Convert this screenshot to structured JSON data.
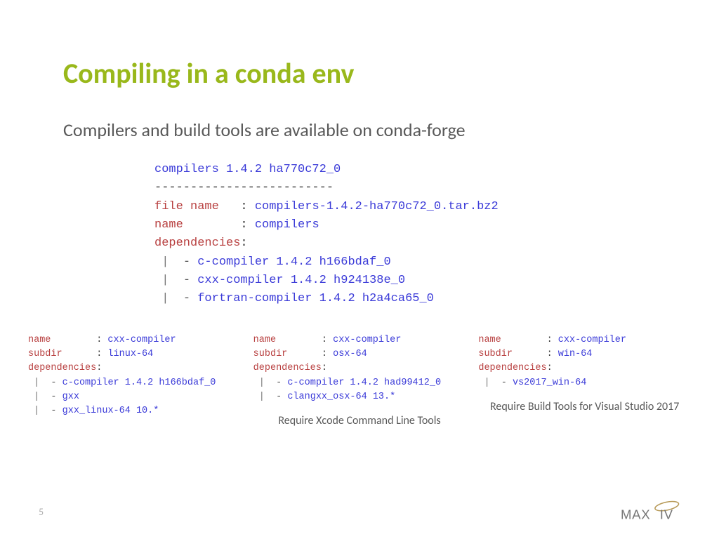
{
  "title": "Compiling in a conda env",
  "subtitle": "Compilers and build tools are available on conda-forge",
  "pageNumber": "5",
  "mainBlock": {
    "header": "compilers 1.4.2 ha770c72_0",
    "divider": "-------------------------",
    "rows": [
      {
        "key": "file name   ",
        "sep": ": ",
        "val": "compilers-1.4.2-ha770c72_0.tar.bz2"
      },
      {
        "key": "name        ",
        "sep": ": ",
        "val": "compilers"
      },
      {
        "key": "dependencies",
        "sep": ":",
        "val": ""
      }
    ],
    "deps": [
      "c-compiler 1.4.2 h166bdaf_0",
      "cxx-compiler 1.4.2 h924138e_0",
      "fortran-compiler 1.4.2 h2a4ca65_0"
    ]
  },
  "columns": [
    {
      "rows": [
        {
          "key": "name        ",
          "sep": ": ",
          "val": "cxx-compiler"
        },
        {
          "key": "subdir      ",
          "sep": ": ",
          "val": "linux-64"
        },
        {
          "key": "dependencies",
          "sep": ":",
          "val": ""
        }
      ],
      "deps": [
        "c-compiler 1.4.2 h166bdaf_0",
        "gxx",
        "gxx_linux-64 10.*"
      ],
      "caption": ""
    },
    {
      "rows": [
        {
          "key": "name        ",
          "sep": ": ",
          "val": "cxx-compiler"
        },
        {
          "key": "subdir      ",
          "sep": ": ",
          "val": "osx-64"
        },
        {
          "key": "dependencies",
          "sep": ":",
          "val": ""
        }
      ],
      "deps": [
        "c-compiler 1.4.2 had99412_0",
        "clangxx_osx-64 13.*"
      ],
      "caption": "Require Xcode Command Line Tools"
    },
    {
      "rows": [
        {
          "key": "name        ",
          "sep": ": ",
          "val": "cxx-compiler"
        },
        {
          "key": "subdir      ",
          "sep": ": ",
          "val": "win-64"
        },
        {
          "key": "dependencies",
          "sep": ":",
          "val": ""
        }
      ],
      "deps": [
        "vs2017_win-64"
      ],
      "caption": "Require Build Tools for Visual Studio 2017"
    }
  ],
  "logoText": "MAX IV"
}
